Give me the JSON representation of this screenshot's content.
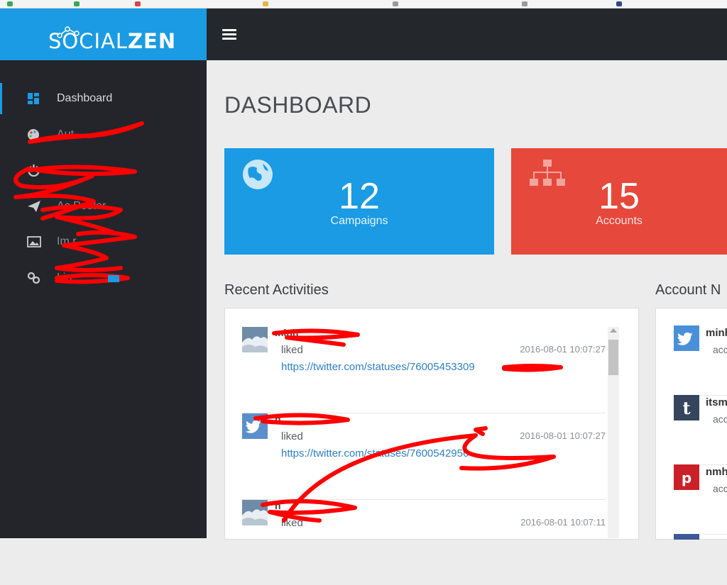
{
  "app": {
    "logo_thin": "SOCIAL",
    "logo_bold": "ZEN"
  },
  "sidebar": {
    "items": [
      {
        "label": "Dashboard",
        "icon": "dashboard-icon",
        "active": true
      },
      {
        "label": "Aut",
        "icon": "palette-icon",
        "active": false
      },
      {
        "label": "",
        "icon": "power-icon",
        "active": false
      },
      {
        "label": "Ac   Poster",
        "icon": "paper-plane-icon",
        "active": false
      },
      {
        "label": "Im   r",
        "icon": "image-icon",
        "active": false
      },
      {
        "label": "Lin",
        "icon": "link-icon",
        "active": false
      }
    ]
  },
  "header": {
    "menu_icon": "hamburger-icon"
  },
  "page": {
    "title": "DASHBOARD"
  },
  "stats": [
    {
      "value": "12",
      "label": "Campaigns",
      "icon": "globe-icon",
      "color": "#1a9be3"
    },
    {
      "value": "15",
      "label": "Accounts",
      "icon": "sitemap-icon",
      "color": "#e6483c"
    }
  ],
  "recent": {
    "title": "Recent Activities",
    "items": [
      {
        "name": "minh",
        "action": "liked",
        "time": "2016-08-01 10:07:27",
        "link": "https://twitter.com/statuses/76005453309",
        "avatar": "photo-avatar"
      },
      {
        "name": "n",
        "action": "liked",
        "time": "2016-08-01 10:07:27",
        "link": "https://twitter.com/statuses/7600542956",
        "avatar": "twitter-icon"
      },
      {
        "name": "n",
        "action": "liked",
        "time": "2016-08-01 10:07:11",
        "link": "",
        "avatar": "photo-avatar"
      }
    ]
  },
  "accounts": {
    "title": "Account N",
    "items": [
      {
        "name": "minh",
        "sub": "acc",
        "icon": "twitter-icon",
        "color": "#4a90d9"
      },
      {
        "name": "itsm",
        "sub": "acc",
        "icon": "tumblr-icon",
        "color": "#35465c"
      },
      {
        "name": "nmh",
        "sub": "acc",
        "icon": "pinterest-icon",
        "color": "#cb2027"
      }
    ]
  },
  "colors": {
    "accent": "#1a9be3",
    "danger": "#e6483c",
    "sidebar": "#23252b"
  }
}
